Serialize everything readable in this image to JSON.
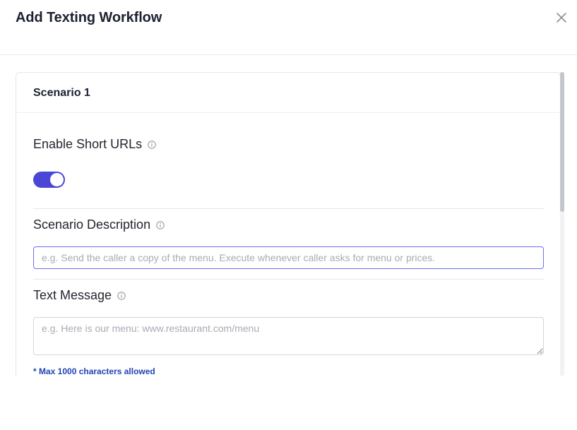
{
  "modal": {
    "title": "Add Texting Workflow",
    "close_icon": "close-icon"
  },
  "scenario": {
    "title": "Scenario 1",
    "short_urls": {
      "label": "Enable Short URLs",
      "info_icon": "info-icon",
      "enabled": true
    },
    "description": {
      "label": "Scenario Description",
      "info_icon": "info-icon",
      "value": "",
      "placeholder": "e.g. Send the caller a copy of the menu. Execute whenever caller asks for menu or prices."
    },
    "text_message": {
      "label": "Text Message",
      "info_icon": "info-icon",
      "value": "",
      "placeholder": "e.g. Here is our menu: www.restaurant.com/menu",
      "hint": "* Max 1000 characters allowed"
    }
  },
  "colors": {
    "accent": "#4a47d6",
    "hint": "#1f43b5",
    "input_focus_border": "#6c6ff0"
  }
}
